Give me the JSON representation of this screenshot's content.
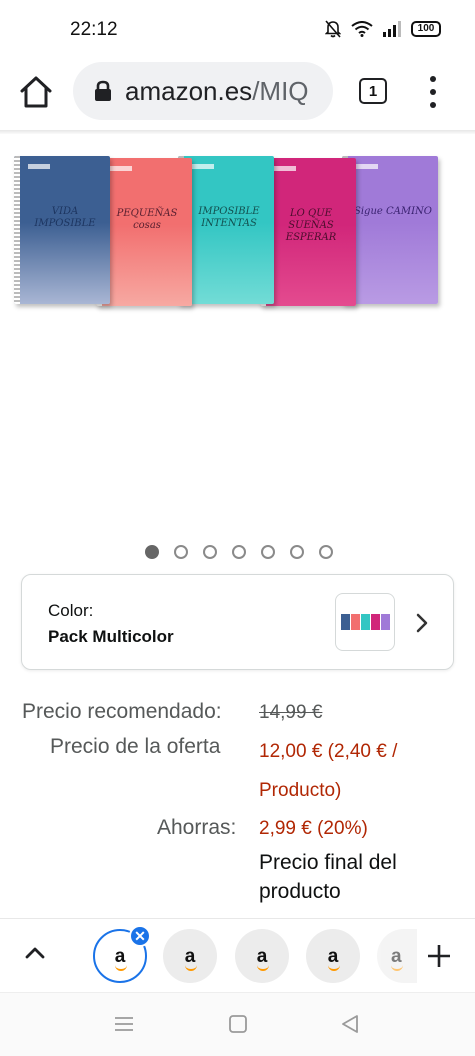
{
  "status_bar": {
    "time": "22:12",
    "battery": "100"
  },
  "browser": {
    "url_host": "amazon.es",
    "url_path": "/MIQ",
    "tab_count": "1"
  },
  "product": {
    "notebooks": [
      {
        "color": "#3c5f92",
        "color2": "#a9b6d4",
        "phrase": "VIDA IMPOSIBLE",
        "text_color": "#1d3560"
      },
      {
        "color": "#f26f6f",
        "color2": "#f7a9a2",
        "phrase": "PEQUEÑAS cosas",
        "text_color": "#5a2030"
      },
      {
        "color": "#33c6c3",
        "color2": "#72dcd6",
        "phrase": "IMPOSIBLE INTENTAS",
        "text_color": "#12504f"
      },
      {
        "color": "#d1267a",
        "color2": "#e44b8f",
        "phrase": "LO QUE SUEÑAS ESPERAR",
        "text_color": "#4a0d2c"
      },
      {
        "color": "#a07ad8",
        "color2": "#b99be4",
        "phrase": "Sigue CAMINO",
        "text_color": "#3a2270"
      }
    ],
    "carousel": {
      "total": 7,
      "active": 0
    }
  },
  "color_selector": {
    "label": "Color:",
    "value": "Pack Multicolor",
    "swatch_colors": [
      "#3c5f92",
      "#f26f6f",
      "#33c6c3",
      "#d1267a",
      "#a07ad8"
    ]
  },
  "pricing": {
    "list_label": "Precio recomendado:",
    "list_price": "14,99 €",
    "deal_label": "Precio de la oferta",
    "deal_price_line1": "12,00 € (2,40 € /",
    "deal_price_line2": "Producto)",
    "savings_label": "Ahorras:",
    "savings_value": "2,99 € (20%)",
    "final_line1": "Precio final del",
    "final_line2": "producto"
  },
  "tab_strip": {
    "favicon_letter": "a",
    "tabs": 5
  },
  "colors": {
    "deal_red": "#b12704",
    "active_tab_blue": "#1a73e8",
    "amazon_orange": "#ff9900"
  }
}
